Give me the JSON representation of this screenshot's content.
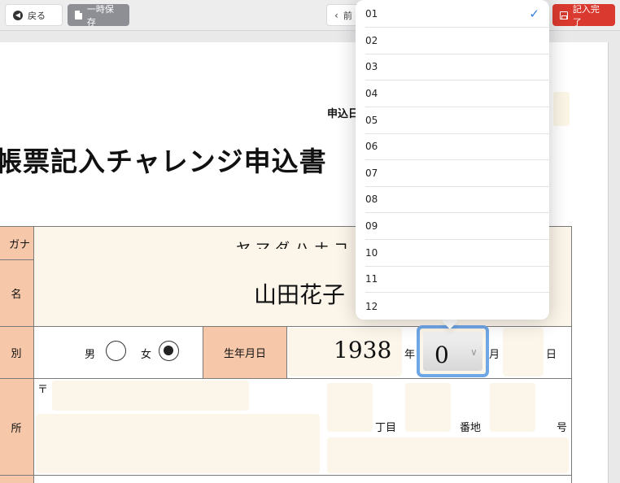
{
  "toolbar": {
    "back_label": "戻る",
    "save_label": "一時保存",
    "prev_label": "前",
    "done_label": "記入完了"
  },
  "form": {
    "apply_date_label": "申込日",
    "title": "帳票記入チャレンジ申込書",
    "furigana_label": "ガナ",
    "furigana_value": "ヤマダハナコ",
    "name_label": "名",
    "name_value": "山田花子",
    "gender_label": "別",
    "male_label": "男",
    "female_label": "女",
    "selected_gender": "女",
    "birth_label": "生年月日",
    "birth_year": "1938",
    "year_unit": "年",
    "birth_month": "0",
    "month_unit": "月",
    "day_unit": "日",
    "address_label": "所",
    "postal_mark": "〒",
    "chome_label": "丁目",
    "banchi_label": "番地",
    "go_label": "号"
  },
  "month_dropdown": {
    "selected": "01",
    "options": [
      "01",
      "02",
      "03",
      "04",
      "05",
      "06",
      "07",
      "08",
      "09",
      "10",
      "11",
      "12"
    ],
    "check_icon": "checkmark-icon"
  },
  "colors": {
    "label_bg": "#f6c7a9",
    "input_bg": "#fcf6ea",
    "focus_ring": "#6fa6e6",
    "done_button": "#d9392f",
    "check": "#2f7fe0"
  }
}
